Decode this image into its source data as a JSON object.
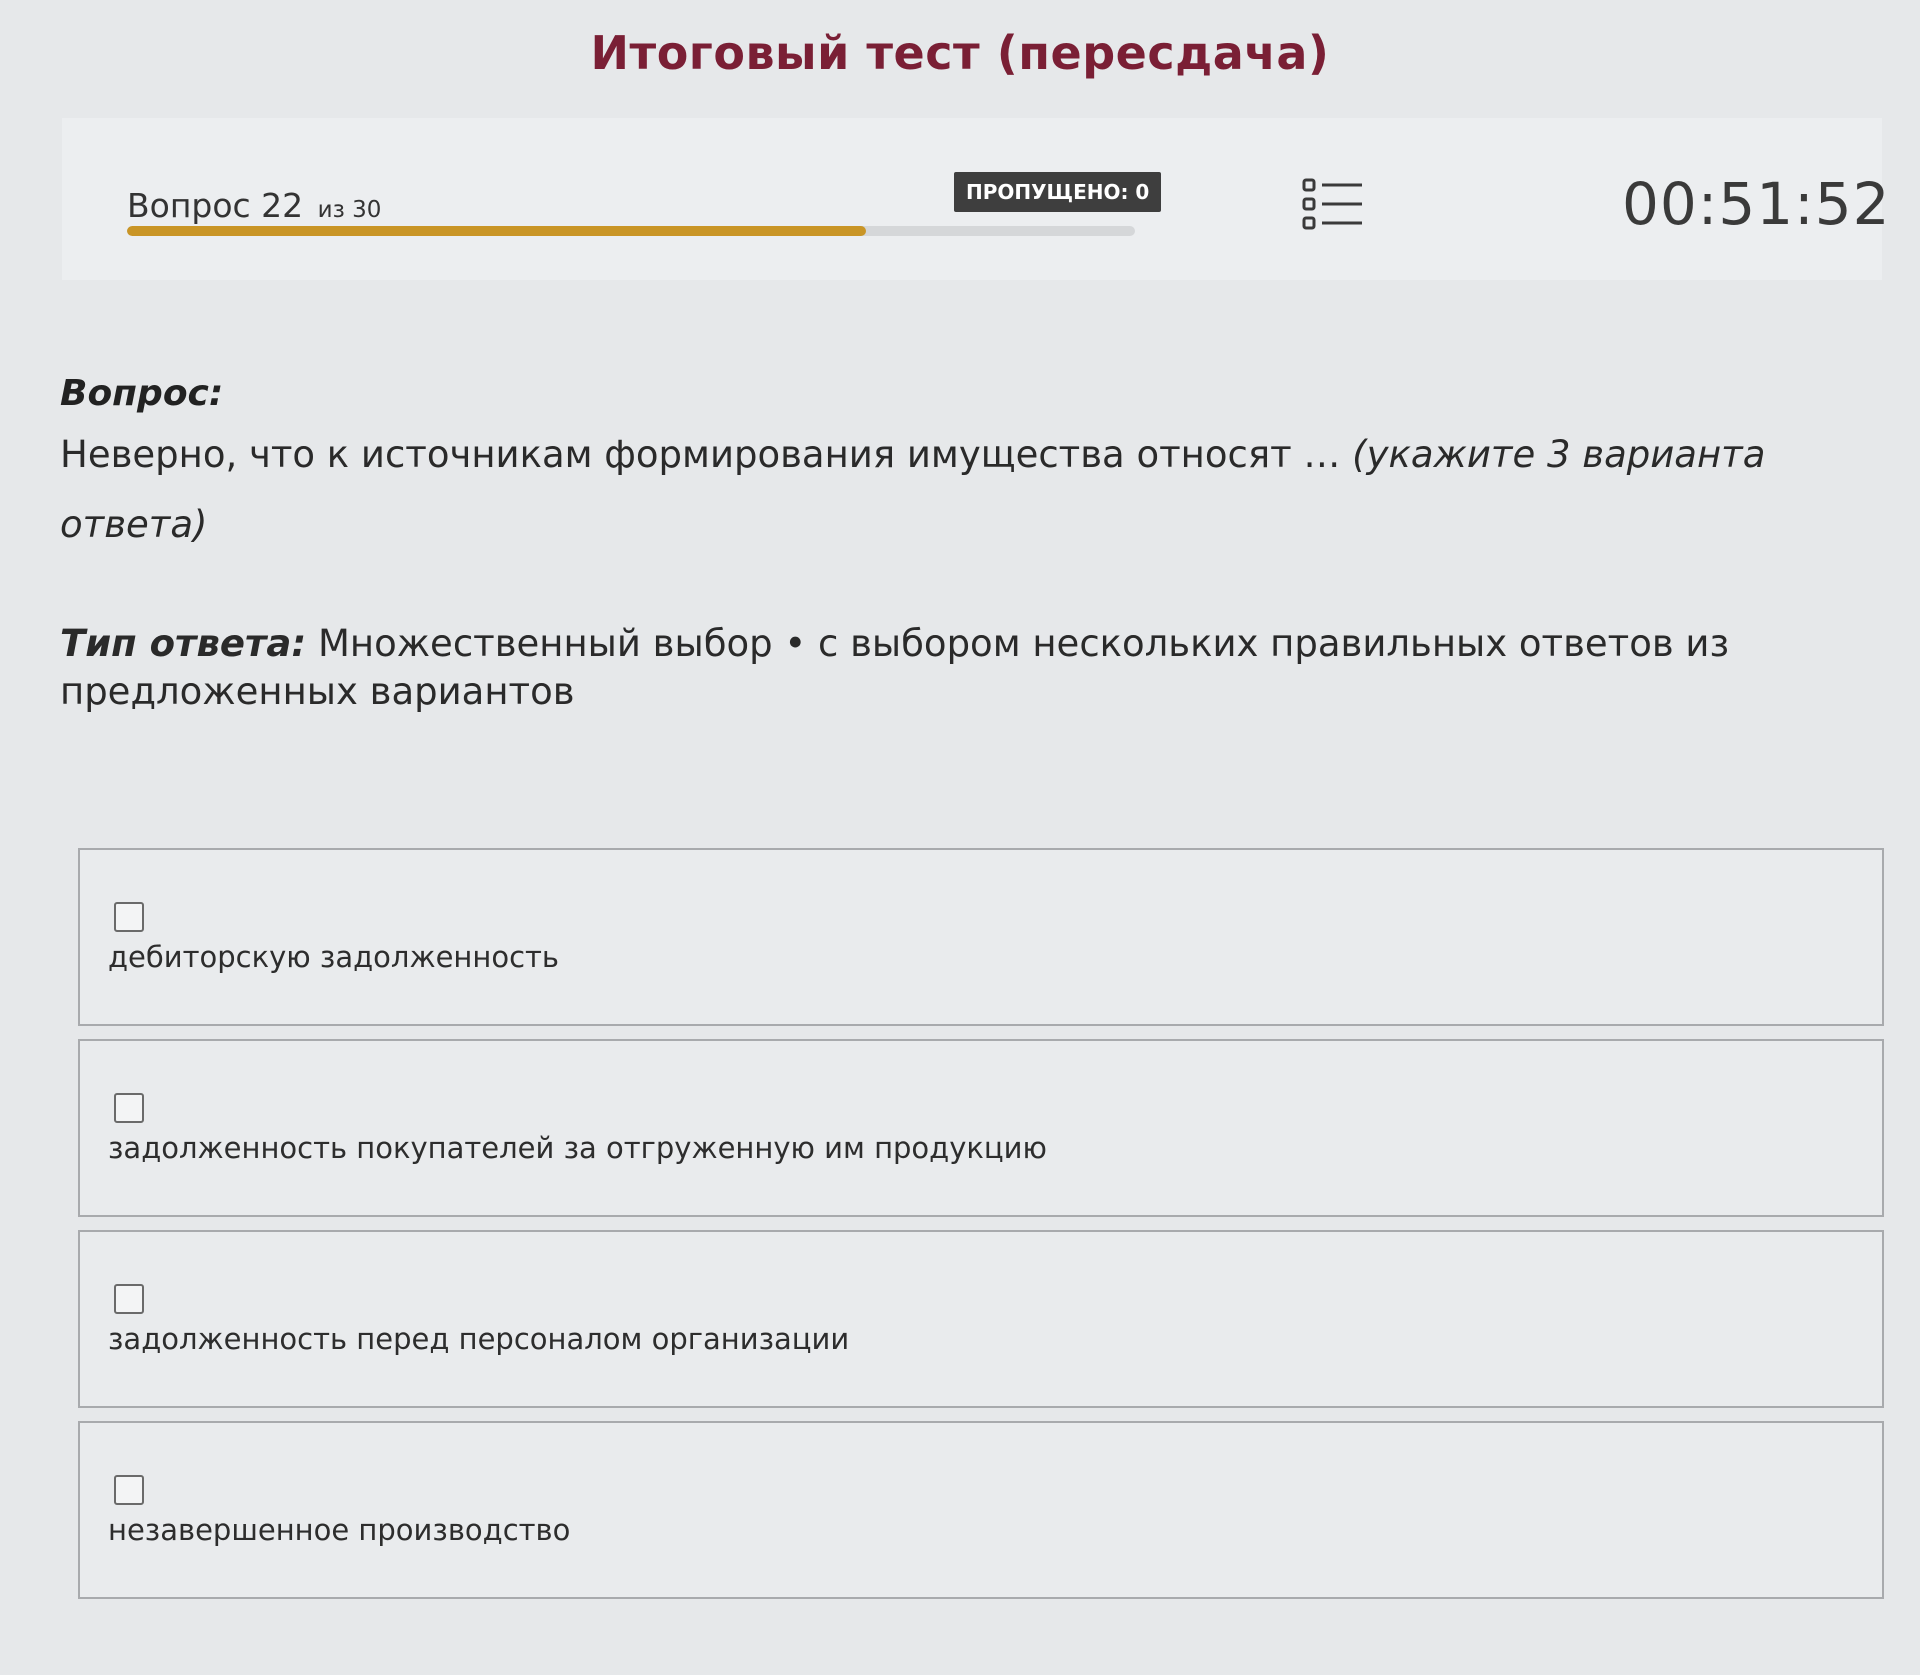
{
  "header": {
    "title": "Итоговый тест (пересдача)"
  },
  "progress": {
    "question_label": "Вопрос 22",
    "of_label": "из 30",
    "current": 22,
    "total": 30,
    "fraction": 0.733,
    "skipped_label": "ПРОПУЩЕНО: 0",
    "timer": "00:51:52",
    "list_icon": "question-list-icon",
    "accent_color": "#c99526"
  },
  "question": {
    "label": "Вопрос:",
    "text": "Неверно, что к источникам формирования имущества относят …",
    "hint": "(укажите 3 варианта ответа)"
  },
  "answer_type": {
    "label": "Тип ответа:",
    "value": "Множественный выбор • с выбором нескольких правильных ответов из предложенных вариантов"
  },
  "options": [
    {
      "text": "дебиторскую задолженность"
    },
    {
      "text": "задолженность покупателей за отгруженную им продукцию"
    },
    {
      "text": "задолженность перед персоналом организации"
    },
    {
      "text": "незавершенное производство"
    }
  ]
}
